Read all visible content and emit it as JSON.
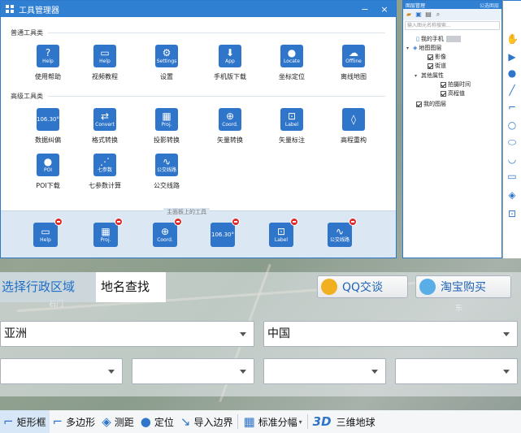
{
  "tool_manager": {
    "title": "工具管理器",
    "close_label": "×",
    "minimize_label": "−",
    "general_section": "普通工具类",
    "advanced_section": "高级工具类",
    "general_tools": [
      {
        "label": "使用帮助",
        "glyph": "?",
        "cap": "Help",
        "icon": "help-icon"
      },
      {
        "label": "视频教程",
        "glyph": "▭",
        "cap": "Help",
        "icon": "video-icon"
      },
      {
        "label": "设置",
        "glyph": "⚙",
        "cap": "Settings",
        "icon": "gear-icon"
      },
      {
        "label": "手机版下载",
        "glyph": "⬇",
        "cap": "App",
        "icon": "phone-download-icon"
      },
      {
        "label": "坐标定位",
        "glyph": "●",
        "cap": "Locate",
        "icon": "locate-pin-icon"
      },
      {
        "label": "离线地图",
        "glyph": "☁",
        "cap": "Offline",
        "icon": "offline-map-icon"
      }
    ],
    "advanced_tools": [
      {
        "label": "数据纠偏",
        "glyph": "106.30°",
        "cap": "",
        "icon": "coordinate-offset-icon"
      },
      {
        "label": "格式转换",
        "glyph": "⇄",
        "cap": "Convert",
        "icon": "convert-icon"
      },
      {
        "label": "投影转换",
        "glyph": "▦",
        "cap": "Proj.",
        "icon": "projection-icon"
      },
      {
        "label": "矢量转换",
        "glyph": "⊕",
        "cap": "Coord.",
        "icon": "vector-convert-icon"
      },
      {
        "label": "矢量标注",
        "glyph": "⊡",
        "cap": "Label",
        "icon": "label-icon"
      },
      {
        "label": "高程重构",
        "glyph": "◊",
        "cap": "",
        "icon": "elevation-icon"
      },
      {
        "label": "POI下载",
        "glyph": "●",
        "cap": "POI",
        "icon": "poi-icon"
      },
      {
        "label": "七参数计算",
        "glyph": "⋰",
        "cap": "七参数",
        "icon": "seven-params-icon"
      },
      {
        "label": "公交线路",
        "glyph": "∿",
        "cap": "公交线路",
        "icon": "bus-route-icon"
      }
    ],
    "home_strip_title": "主面板上的工具",
    "home_tools": [
      {
        "glyph": "▭",
        "cap": "Help"
      },
      {
        "glyph": "▦",
        "cap": "Proj."
      },
      {
        "glyph": "⊕",
        "cap": "Coord."
      },
      {
        "glyph": "106.30°",
        "cap": ""
      },
      {
        "glyph": "⊡",
        "cap": "Label"
      },
      {
        "glyph": "∿",
        "cap": "公交线路"
      }
    ]
  },
  "layer_panel": {
    "title": "图层管理",
    "title_right": "公选图层",
    "search_placeholder": "输入图元名称搜索...",
    "items": {
      "my_phone": "我的手机",
      "map_layers": "地图图层",
      "imagery": "影像",
      "road": "街道",
      "other_props": "其他属性",
      "capture_time": "拍摄时间",
      "elevation": "高程值",
      "my_layers": "我的图层"
    }
  },
  "region": {
    "tab_admin": "选择行政区域",
    "tab_place": "地名查找",
    "qq_btn": "QQ交谈",
    "taobao_btn": "淘宝购买",
    "continent": "亚洲",
    "country": "中国",
    "colors": {
      "accent": "#2f75c9",
      "titlebar": "#2f7fd3"
    }
  },
  "bottom_toolbar": {
    "rect": "矩形框",
    "polygon": "多边形",
    "measure": "测距",
    "locate": "定位",
    "import": "导入边界",
    "grid": "标准分幅",
    "three_d_mark": "3D",
    "three_d_label": "三维地球"
  },
  "map": {
    "label_a": "石门",
    "label_b": "东"
  }
}
